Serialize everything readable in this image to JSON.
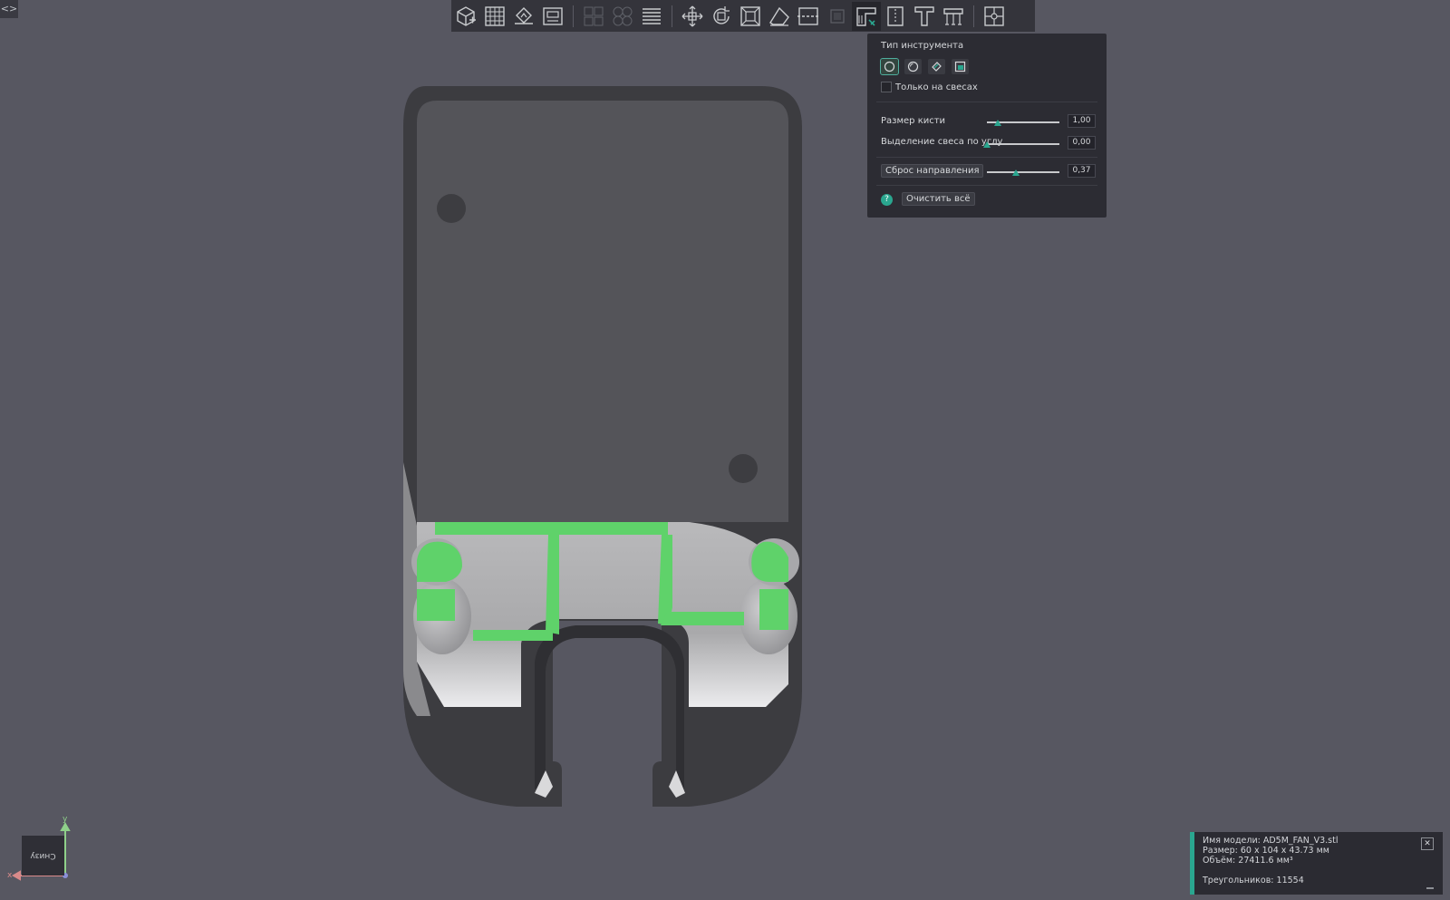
{
  "toolbar": {
    "buttons": [
      {
        "name": "add-model",
        "icon": "cube-add-icon"
      },
      {
        "name": "arrange",
        "icon": "grid-icon"
      },
      {
        "name": "lay-on-face",
        "icon": "place-icon"
      },
      {
        "name": "auto-orient",
        "icon": "orient-icon"
      },
      {
        "name": "split-objects",
        "icon": "split-objects-icon"
      },
      {
        "name": "split-parts",
        "icon": "split-parts-icon"
      },
      {
        "name": "layers",
        "icon": "layers-icon"
      },
      {
        "name": "move",
        "icon": "move-icon"
      },
      {
        "name": "rotate",
        "icon": "rotate-icon"
      },
      {
        "name": "scale",
        "icon": "scale-icon"
      },
      {
        "name": "place-face",
        "icon": "eraser-face-icon"
      },
      {
        "name": "cut",
        "icon": "cut-icon"
      },
      {
        "name": "support-disabled",
        "icon": "support-icon"
      },
      {
        "name": "support-paint",
        "icon": "support-paint-icon"
      },
      {
        "name": "seam-paint",
        "icon": "seam-icon"
      },
      {
        "name": "text",
        "icon": "text-icon"
      },
      {
        "name": "measure",
        "icon": "measure-icon"
      },
      {
        "name": "assembly",
        "icon": "assembly-icon"
      }
    ]
  },
  "panel": {
    "title": "Тип инструмента",
    "tools": [
      "circle-brush-icon",
      "sphere-brush-icon",
      "fill-icon",
      "gap-fill-icon"
    ],
    "overhang_only": "Только на свесах",
    "brush_size_label": "Размер кисти",
    "brush_size_value": "1,00",
    "brush_size_fraction": 0.15,
    "overhang_angle_label": "Выделение свеса по углу",
    "overhang_angle_value": "0,00",
    "overhang_angle_fraction": 0.0,
    "reset_direction_label": "Сброс направления",
    "reset_direction_value": "0,37",
    "reset_direction_fraction": 0.4,
    "clear_all": "Очистить всё",
    "help": "?"
  },
  "view": {
    "orientation": "Снизу",
    "axis_x": "x",
    "axis_y": "y"
  },
  "info": {
    "model_name": "Имя модели: AD5M_FAN_V3.stl",
    "size": "Размер: 60 x 104 x 43.73 мм",
    "volume": "Объём: 27411.6 мм³",
    "triangles": "Треугольников: 11554"
  },
  "colors": {
    "background": "#575761",
    "paint": "#5fd26a",
    "accent": "#2aa68f"
  }
}
